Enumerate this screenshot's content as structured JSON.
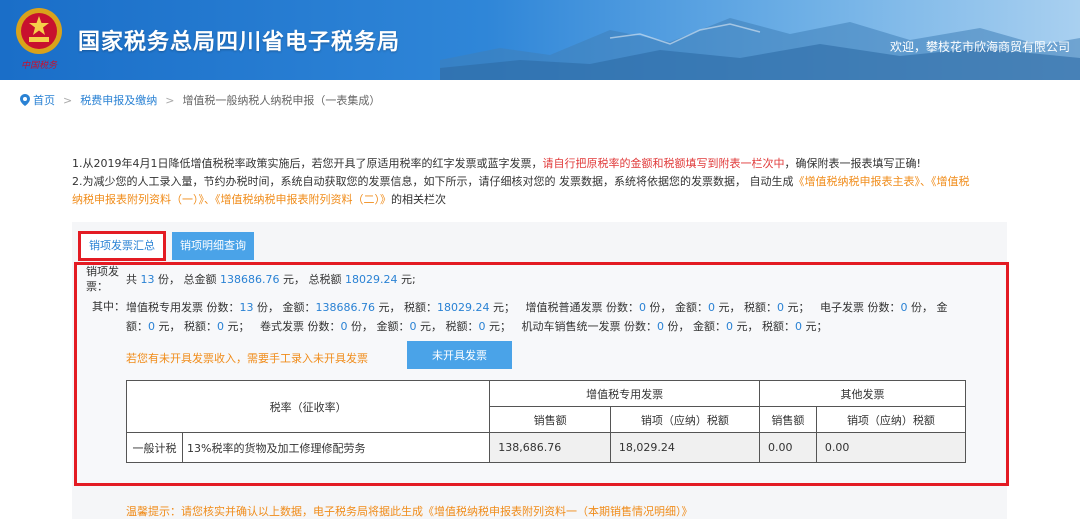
{
  "header": {
    "emblem_text": "中国税务",
    "title": "国家税务总局四川省电子税务局",
    "welcome": "欢迎，攀枝花市欣海商贸有限公司"
  },
  "breadcrumb": {
    "home": "首页",
    "level1": "税费申报及缴纳",
    "current": "增值税一般纳税人纳税申报（一表集成）",
    "separator": ">"
  },
  "notice": {
    "line1_pre": "1.从2019年4月1日降低增值税税率政策实施后，若您开具了原适用税率的红字发票或蓝字发票，",
    "line1_red": "请自行把原税率的金额和税额填写到附表一栏次中",
    "line1_post": "，确保附表一报表填写正确!",
    "line2_pre": "2.为减少您的人工录入量，节约办税时间，系统自动获取您的发票信息，如下所示，请仔细核对您的 发票数据，系统将依据您的发票数据， 自动生成",
    "link1": "《增值税纳税申报表主表》、",
    "link2": "《增值税纳税申报表附列资料（一）》、",
    "link3": "《增值税纳税申报表附列资料（二）》",
    "line2_post": "的相关栏次"
  },
  "tabs": {
    "summary": "销项发票汇总",
    "detail": "销项明细查询"
  },
  "summary": {
    "label": "销项发票：",
    "total_pre": "共",
    "count": "13",
    "count_unit": "份，",
    "amount_label": "总金额",
    "amount": "138686.76",
    "amount_unit": "元，",
    "tax_label": "总税额",
    "tax": "18029.24",
    "tax_unit": "元;"
  },
  "detail": {
    "label": "其中：",
    "special": {
      "name": "增值税专用发票 份数：",
      "count": "13",
      "amount": "138686.76",
      "tax": "18029.24"
    },
    "normal": {
      "name": "增值税普通发票 份数：",
      "count": "0",
      "amount": "0",
      "tax": "0"
    },
    "electronic": {
      "name": "电子发票 份数：",
      "count": "0",
      "amount": "0",
      "tax": "0"
    },
    "roll": {
      "name": "卷式发票 份数：",
      "count": "0",
      "amount": "0",
      "tax": "0"
    },
    "vehicle": {
      "name": "机动车销售统一发票 份数：",
      "count": "0",
      "amount": "0",
      "tax": "0"
    },
    "unit_fen": "份，",
    "amount_label": "金额：",
    "tax_label": "税额：",
    "yuan_comma": "元，",
    "yuan_semi": "元；"
  },
  "unissued": {
    "hint": "若您有未开具发票收入，需要手工录入未开具发票",
    "button": "未开具发票"
  },
  "table": {
    "rate_header": "税率（征收率）",
    "special_header": "增值税专用发票",
    "other_header": "其他发票",
    "sales": "销售额",
    "output_tax": "销项（应纳）税额",
    "rows": [
      {
        "category": "一般计税",
        "description": "13%税率的货物及加工修理修配劳务",
        "special_sales": "138,686.76",
        "special_tax": "18,029.24",
        "other_sales": "0.00",
        "other_tax": "0.00"
      }
    ]
  },
  "footer": {
    "hint_pre": "温馨提示：请您核实并确认以上数据，电子税务局将据此生成",
    "hint_link": "《增值税纳税申报表附列资料一（本期销售情况明细）》"
  },
  "colors": {
    "accent": "#2a82d4",
    "button": "#4aa3e8",
    "highlight": "#e31b23",
    "warning": "#f08c1a"
  }
}
